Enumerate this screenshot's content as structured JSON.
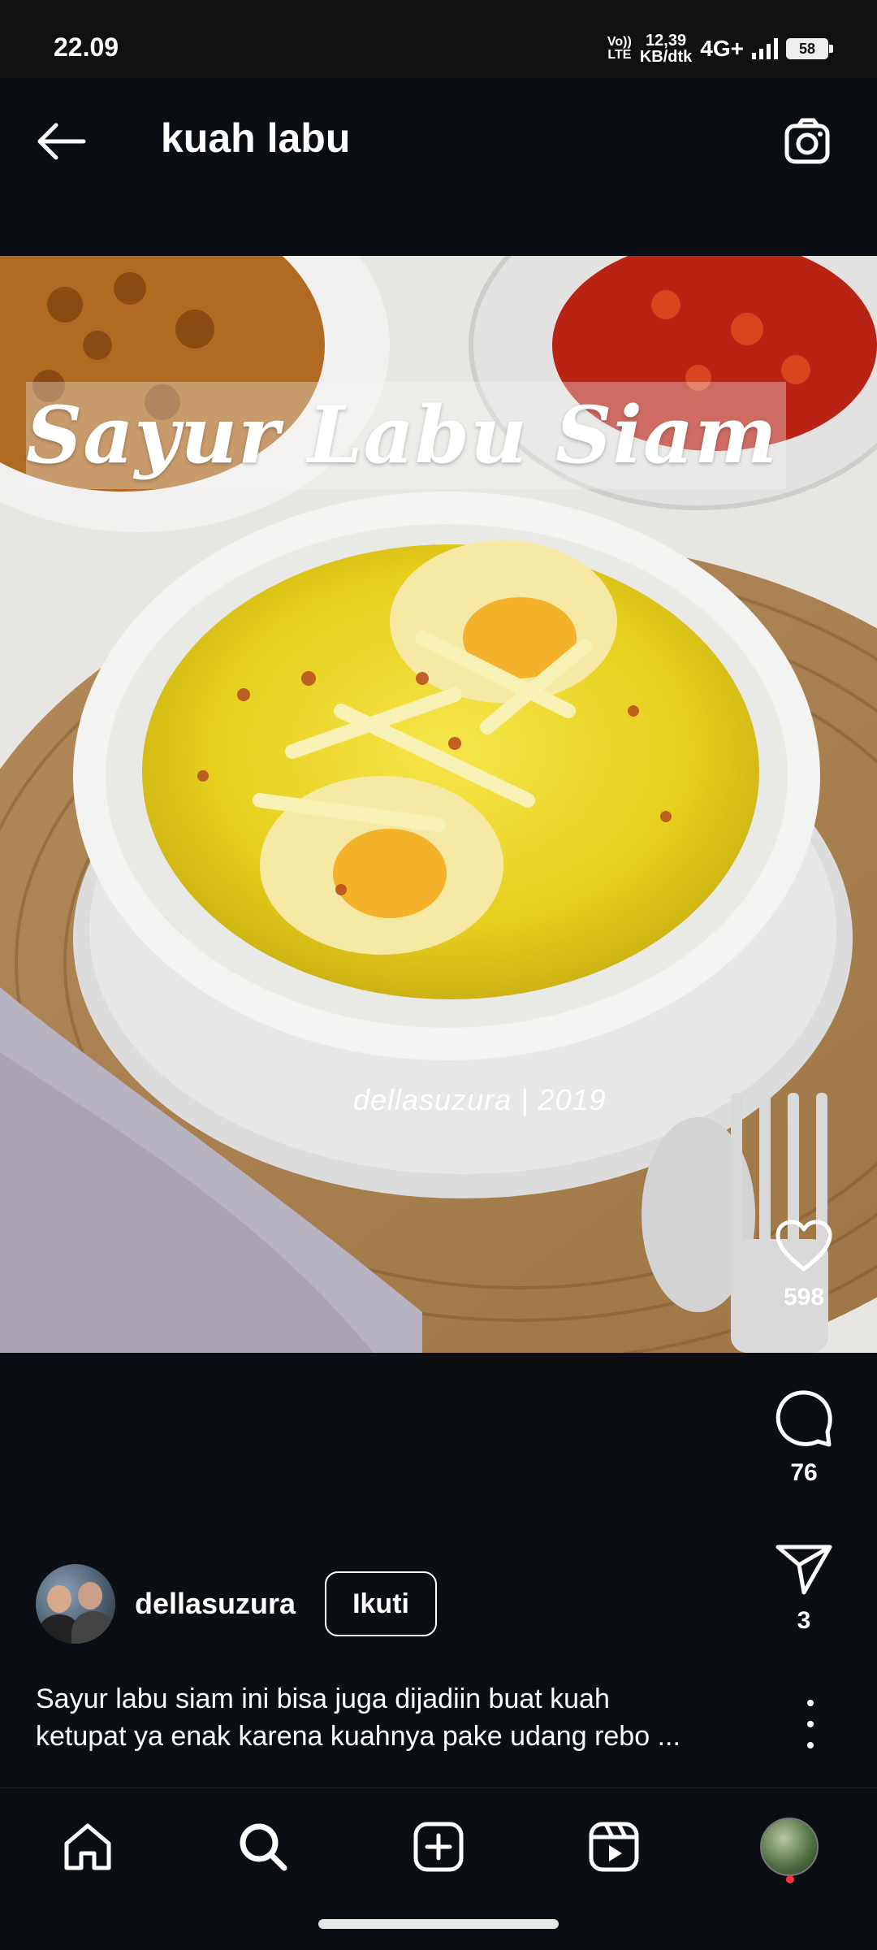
{
  "status_bar": {
    "time": "22.09",
    "volte": "Vo))",
    "lte": "LTE",
    "speed_value": "12,39",
    "speed_unit": "KB/dtk",
    "network": "4G+",
    "battery": "58"
  },
  "header": {
    "title": "kuah labu",
    "back_icon": "arrow-left-icon",
    "camera_icon": "camera-icon"
  },
  "post": {
    "image_overlay_title": "Sayur Labu Siam",
    "watermark": "dellasuzura | 2019",
    "likes": "598",
    "comments": "76",
    "shares": "3",
    "author": "dellasuzura",
    "follow_label": "Ikuti",
    "caption_line1": "Sayur labu siam ini bisa juga dijadiin buat kuah",
    "caption_line2": "ketupat ya enak karena kuahnya pake udang rebo ..."
  },
  "bottom_nav": {
    "items": [
      "home-icon",
      "search-icon",
      "create-icon",
      "reels-icon",
      "profile-icon"
    ]
  },
  "colors": {
    "background": "#0b0f14",
    "text": "#ffffff",
    "notification": "#ff3040"
  }
}
